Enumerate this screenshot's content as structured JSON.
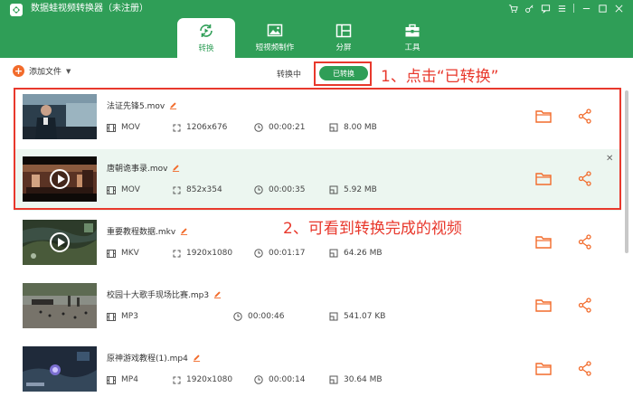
{
  "app": {
    "title": "数据蛙视频转换器（未注册）"
  },
  "window_controls": [
    "cart-icon",
    "key-icon",
    "feedback-icon",
    "menu-icon",
    "minimize-icon",
    "maximize-icon",
    "close-icon"
  ],
  "tabs": [
    {
      "label": "转换",
      "icon": "convert-icon",
      "active": true
    },
    {
      "label": "短视频制作",
      "icon": "image-icon",
      "active": false
    },
    {
      "label": "分屏",
      "icon": "split-screen-icon",
      "active": false
    },
    {
      "label": "工具",
      "icon": "toolbox-icon",
      "active": false
    }
  ],
  "toolbar": {
    "add_label": "添加文件",
    "converting_label": "转换中",
    "converted_label": "已转换"
  },
  "annotations": {
    "step1": "1、点击“已转换”",
    "step2": "2、可看到转换完成的视频"
  },
  "files": [
    {
      "name": "法证先锋5.mov",
      "format": "MOV",
      "resolution": "1206x676",
      "duration": "00:00:21",
      "size": "8.00 MB",
      "thumb": "office-scene"
    },
    {
      "name": "唐朝诡事录.mov",
      "format": "MOV",
      "resolution": "852x354",
      "duration": "00:00:35",
      "size": "5.92 MB",
      "thumb": "period-drama"
    },
    {
      "name": "重要教程数据.mkv",
      "format": "MKV",
      "resolution": "1920x1080",
      "duration": "00:01:17",
      "size": "64.26 MB",
      "thumb": "game-map"
    },
    {
      "name": "校园十大歌手现场比赛.mp3",
      "format": "MP3",
      "resolution": "",
      "duration": "00:00:46",
      "size": "541.07 KB",
      "thumb": "outdoor-stage"
    },
    {
      "name": "原神游戏教程(1).mp4",
      "format": "MP4",
      "resolution": "1920x1080",
      "duration": "00:00:14",
      "size": "30.64 MB",
      "thumb": "game-night"
    }
  ],
  "colors": {
    "brand_green": "#2f9e57",
    "accent_orange": "#f26b2b",
    "annotation_red": "#e8382c",
    "highlight_row": "#ecf6f0"
  }
}
